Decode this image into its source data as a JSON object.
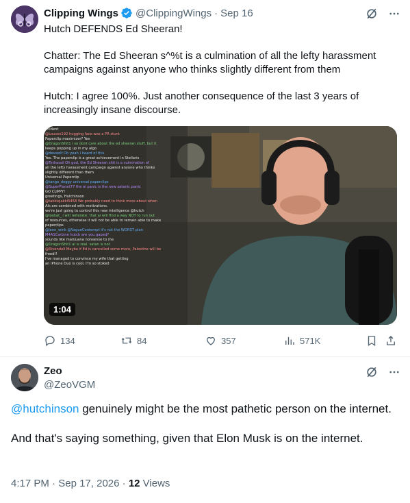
{
  "tweet1": {
    "author_name": "Clipping Wings",
    "handle": "@ClippingWings",
    "separator": "·",
    "date": "Sep 16",
    "paragraphs": [
      "Hutch DEFENDS Ed Sheeran!",
      "Chatter: The Ed Sheeran s^%t is a culmination of all the lefty harassment campaigns against anyone who thinks slightly different from them",
      "Hutch: I agree 100%. Just another consequence of the last 3 years of increasingly insane discourse."
    ],
    "video_duration": "1:04",
    "video_chat": [
      "ncident",
      "@Louves192  hugging face was a PR stunt",
      "Paperclip maximizer? Yes",
      "@DragonShit1  i so dont care about the ed sheeran stuff, but it",
      "keeps popping up in my algo",
      "@devwolf  Oh yeah I heard of this",
      "Yes. The paperclip is a great achievement in Stellaris",
      "@Tydrassil  Oh god, the Ed Sheeran shit is a culmination of",
      "all the lefty harassment campaign against anyone who thinks",
      "slightly different than them",
      "Universal Paperclip",
      "@tango_doggy  universal paperclips",
      "@SuperPlanet77  the ai panic is the new satanic panic",
      "GO CLIPPY!",
      "greetings, Hutchinson",
      "@takkiejakki5458  We probably need to think more about when",
      "AIs are combined with motivations.",
      "we're just going to control this new intelligence @hutch",
      "@lookat_  i will reiterate: that ai will find a way NOT to run out",
      "of resources, otherwise it will not be able to remain able to make",
      "paperclips",
      "@jenn_wink  @VagueContempt it's not the WORST plan",
      "M4A1Carbine  hutch are you gaped?",
      "sounds like marijuana nonsense to me",
      "@DragonShit1  ai is real. satan is not",
      "@Rivendell  Maybe if Ed is cancelled some more, Palestine will be",
      "freed!!",
      "I've managed to convince my wife that getting",
      "an iPhone Duo is cool, I'm so stoked"
    ],
    "actions": {
      "replies": "134",
      "retweets": "84",
      "likes": "357",
      "views": "571K"
    },
    "icons": {
      "verified": "verified-badge-icon",
      "grok": "grok-icon",
      "more": "more-icon"
    },
    "colors": {
      "verified": "#1d9bf0",
      "muted": "#536471"
    }
  },
  "tweet2": {
    "author_name": "Zeo",
    "handle": "@ZeoVGM",
    "mention": "@hutchinson",
    "body_rest": " genuinely might be the most pathetic person on the internet.",
    "body_second": "And that's saying something, given that Elon Musk is on the internet.",
    "time": "4:17 PM",
    "date": "Sep 17, 2026",
    "separator": "·",
    "views_count": "12",
    "views_label": "Views",
    "colors": {
      "mention": "#1d9bf0"
    }
  }
}
